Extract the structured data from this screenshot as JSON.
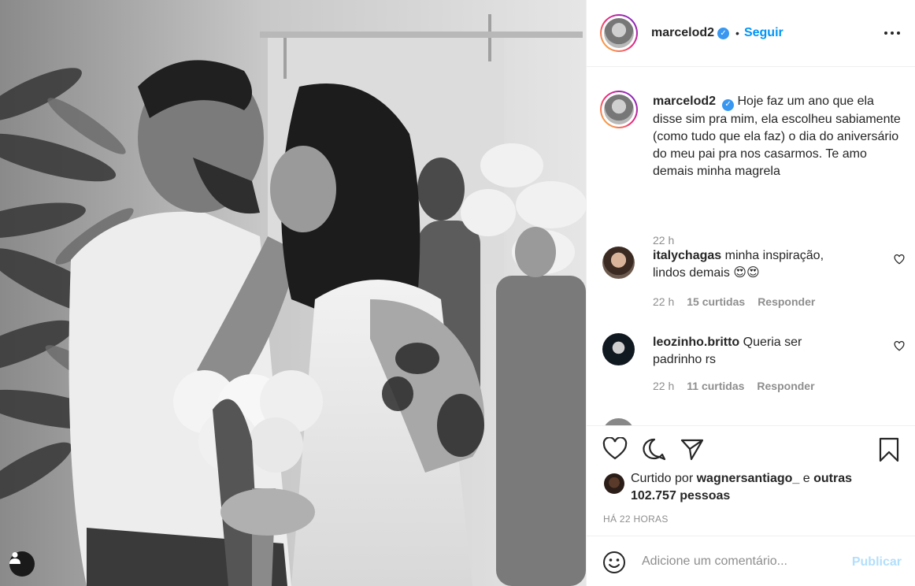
{
  "post": {
    "author": "marcelod2",
    "follow_label": "Seguir",
    "separator": "•",
    "verified_mark": "✓"
  },
  "caption": {
    "author": "marcelod2",
    "text": "Hoje faz um ano que ela disse sim pra mim, ela escolheu sabiamente (como tudo que ela faz) o dia do aniversário do meu pai pra nos casarmos. Te amo demais minha magrela",
    "time": "22 h"
  },
  "comments": [
    {
      "user": "italychagas",
      "text": "minha inspiração, lindos demais 😍😍",
      "time": "22 h",
      "likes": "15 curtidas",
      "reply_label": "Responder"
    },
    {
      "user": "leozinho.britto",
      "text": "Queria ser padrinho rs",
      "time": "22 h",
      "likes": "11 curtidas",
      "reply_label": "Responder"
    }
  ],
  "likes": {
    "prefix": "Curtido por",
    "user": "wagnersantiago_",
    "joiner": "e",
    "others": "outras 102.757 pessoas"
  },
  "timestamp": "Há 22 horas",
  "add_comment": {
    "placeholder": "Adicione um comentário...",
    "publish_label": "Publicar"
  },
  "colors": {
    "accent": "#0095f6",
    "publish_disabled": "#b2dffc",
    "secondary_text": "#8e8e8e",
    "border": "#efefef"
  },
  "icons": [
    "user-tag-icon",
    "more-options-icon",
    "heart-icon",
    "comment-icon",
    "share-icon",
    "bookmark-icon",
    "emoji-icon",
    "verified-icon"
  ]
}
